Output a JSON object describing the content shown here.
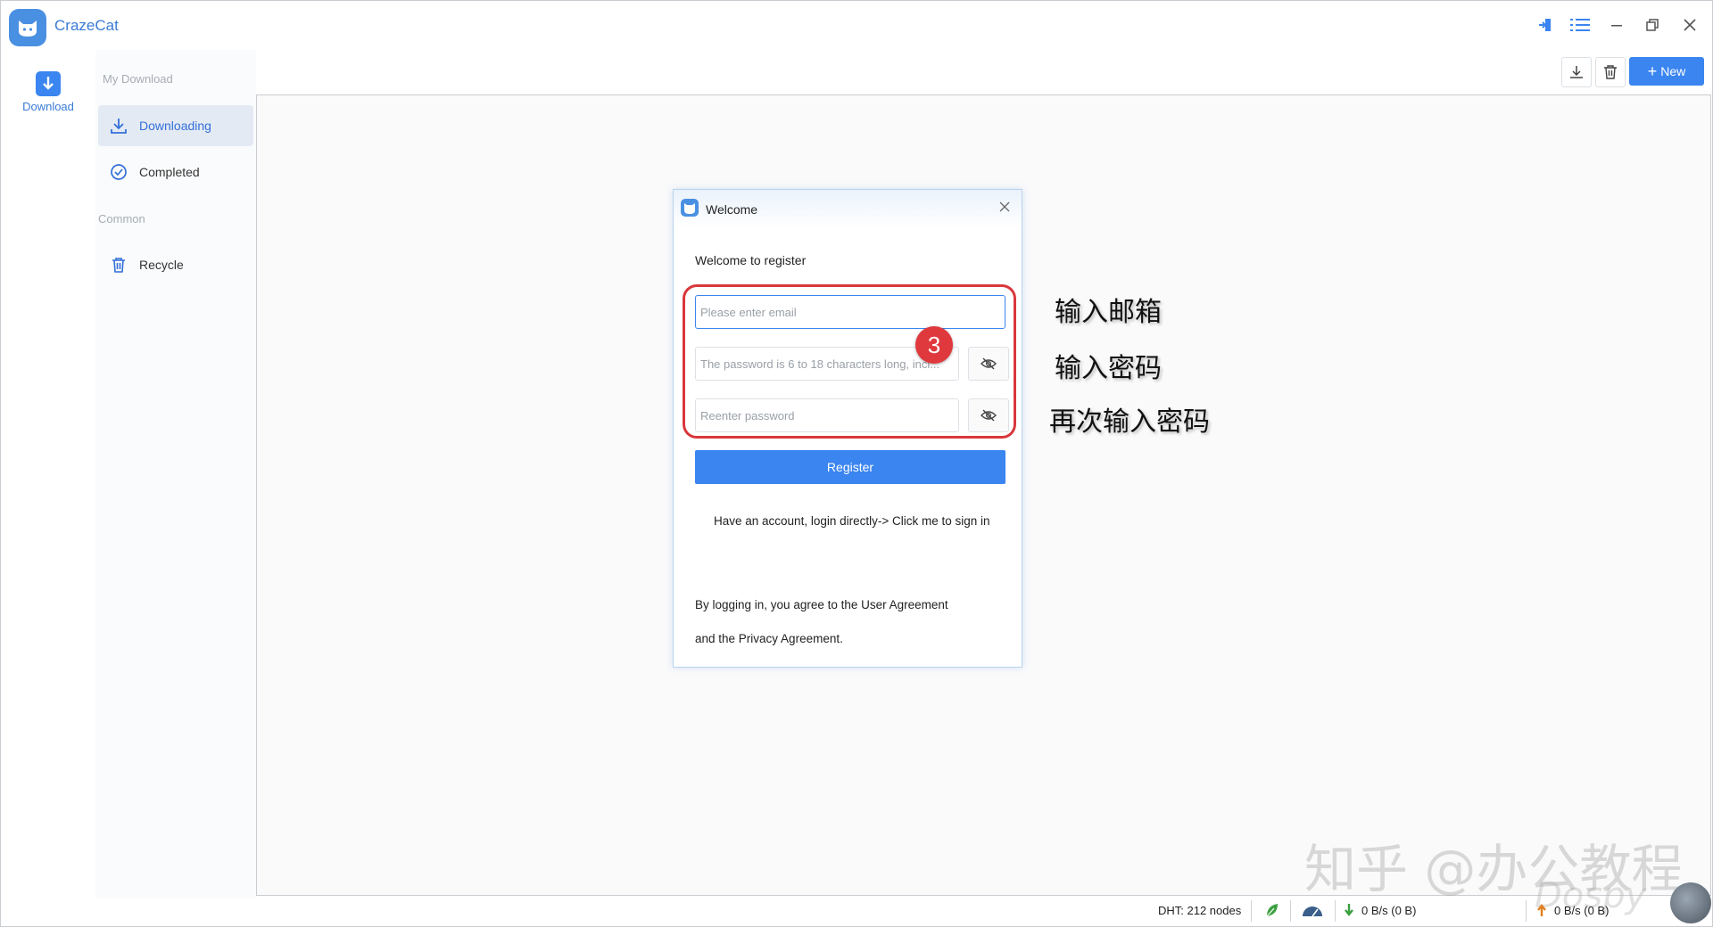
{
  "app": {
    "name": "CrazeCat"
  },
  "rail": {
    "download_label": "Download"
  },
  "sidebar": {
    "section_my": "My Download",
    "items": [
      {
        "label": "Downloading",
        "icon": "download-icon",
        "active": true
      },
      {
        "label": "Completed",
        "icon": "check-circle-icon"
      }
    ],
    "section_common": "Common",
    "common_items": [
      {
        "label": "Recycle",
        "icon": "trash-icon"
      }
    ]
  },
  "toolbar": {
    "new_label": "New"
  },
  "dialog": {
    "title": "Welcome",
    "subtitle": "Welcome to register",
    "email_placeholder": "Please enter email",
    "password_placeholder": "The password is 6 to 18 characters long, incl...",
    "reenter_placeholder": "Reenter password",
    "register_label": "Register",
    "login_prompt": "Have an account, login directly-> Click me to sign in",
    "agreement_line1": "By logging in, you agree to the User Agreement",
    "agreement_line2": "and the Privacy Agreement."
  },
  "annotations": {
    "step_number": "3",
    "email_note": "输入邮箱",
    "password_note": "输入密码",
    "reenter_note": "再次输入密码"
  },
  "status": {
    "dht": "DHT: 212 nodes",
    "download_speed": "0 B/s (0 B)",
    "upload_speed": "0 B/s (0 B)"
  },
  "watermark": {
    "text": "知乎 @办公教程",
    "sub": "Dospy"
  },
  "colors": {
    "accent": "#3a85f0",
    "highlight": "#d9373c"
  }
}
